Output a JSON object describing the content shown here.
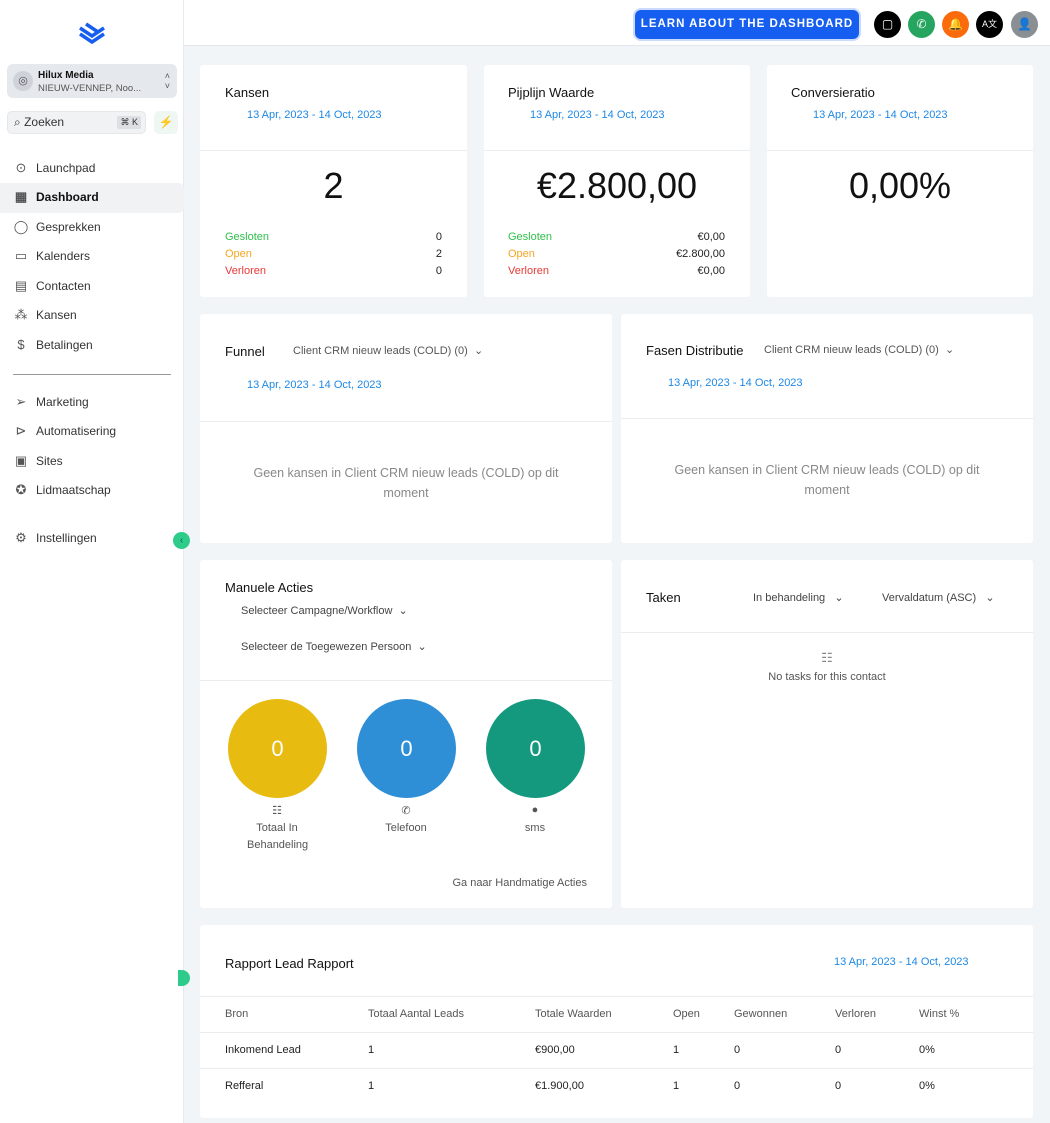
{
  "sidebar": {
    "account": {
      "name": "Hilux Media",
      "location": "NIEUW-VENNEP, Noo..."
    },
    "search": {
      "placeholder": "Zoeken",
      "shortcut": "⌘ K"
    },
    "items": [
      {
        "label": "Launchpad",
        "icon": "rocket-icon"
      },
      {
        "label": "Dashboard",
        "icon": "dashboard-icon"
      },
      {
        "label": "Gesprekken",
        "icon": "chat-icon"
      },
      {
        "label": "Kalenders",
        "icon": "calendar-icon"
      },
      {
        "label": "Contacten",
        "icon": "contacts-icon"
      },
      {
        "label": "Kansen",
        "icon": "opportunities-icon"
      },
      {
        "label": "Betalingen",
        "icon": "payments-icon"
      }
    ],
    "items2": [
      {
        "label": "Marketing",
        "icon": "send-icon"
      },
      {
        "label": "Automatisering",
        "icon": "automation-icon"
      },
      {
        "label": "Sites",
        "icon": "sites-icon"
      },
      {
        "label": "Lidmaatschap",
        "icon": "membership-icon"
      }
    ],
    "settings": "Instellingen"
  },
  "header": {
    "learn_button": "LEARN ABOUT THE DASHBOARD"
  },
  "date_range": "13 Apr, 2023 - 14 Oct, 2023",
  "stats": [
    {
      "title": "Kansen",
      "value": "2",
      "rows": [
        {
          "label": "Gesloten",
          "value": "0"
        },
        {
          "label": "Open",
          "value": "2"
        },
        {
          "label": "Verloren",
          "value": "0"
        }
      ]
    },
    {
      "title": "Pijplijn Waarde",
      "value": "€2.800,00",
      "rows": [
        {
          "label": "Gesloten",
          "value": "€0,00"
        },
        {
          "label": "Open",
          "value": "€2.800,00"
        },
        {
          "label": "Verloren",
          "value": "€0,00"
        }
      ]
    },
    {
      "title": "Conversieratio",
      "value": "0,00%"
    }
  ],
  "colors": {
    "gesloten": "#2fbf4a",
    "open": "#f5a623",
    "verloren": "#e53935",
    "yellow": "#e8bb10",
    "blue": "#2f8fd6",
    "green": "#14997e",
    "brand": "#155eef"
  },
  "funnel": {
    "title": "Funnel",
    "pipeline": "Client CRM nieuw leads (COLD) (0)",
    "empty": "Geen kansen in Client CRM nieuw leads (COLD) op dit moment"
  },
  "fasen": {
    "title": "Fasen Distributie",
    "pipeline": "Client CRM nieuw leads (COLD) (0)",
    "empty": "Geen kansen in Client CRM nieuw leads (COLD) op dit moment"
  },
  "manual": {
    "title": "Manuele Acties",
    "campaign": "Selecteer Campagne/Workflow",
    "person": "Selecteer de Toegewezen Persoon",
    "circles": [
      {
        "value": "0",
        "label": "Totaal In Behandeling"
      },
      {
        "value": "0",
        "label": "Telefoon"
      },
      {
        "value": "0",
        "label": "sms"
      }
    ],
    "link": "Ga naar Handmatige Acties"
  },
  "tasks": {
    "title": "Taken",
    "status": "In behandeling",
    "sort": "Vervaldatum (ASC)",
    "empty": "No tasks for this contact"
  },
  "report": {
    "title": "Rapport Lead Rapport",
    "columns": [
      "Bron",
      "Totaal Aantal Leads",
      "Totale Waarden",
      "Open",
      "Gewonnen",
      "Verloren",
      "Winst %"
    ],
    "rows": [
      [
        "Inkomend Lead",
        "1",
        "€900,00",
        "1",
        "0",
        "0",
        "0%"
      ],
      [
        "Refferal",
        "1",
        "€1.900,00",
        "1",
        "0",
        "0",
        "0%"
      ]
    ]
  }
}
